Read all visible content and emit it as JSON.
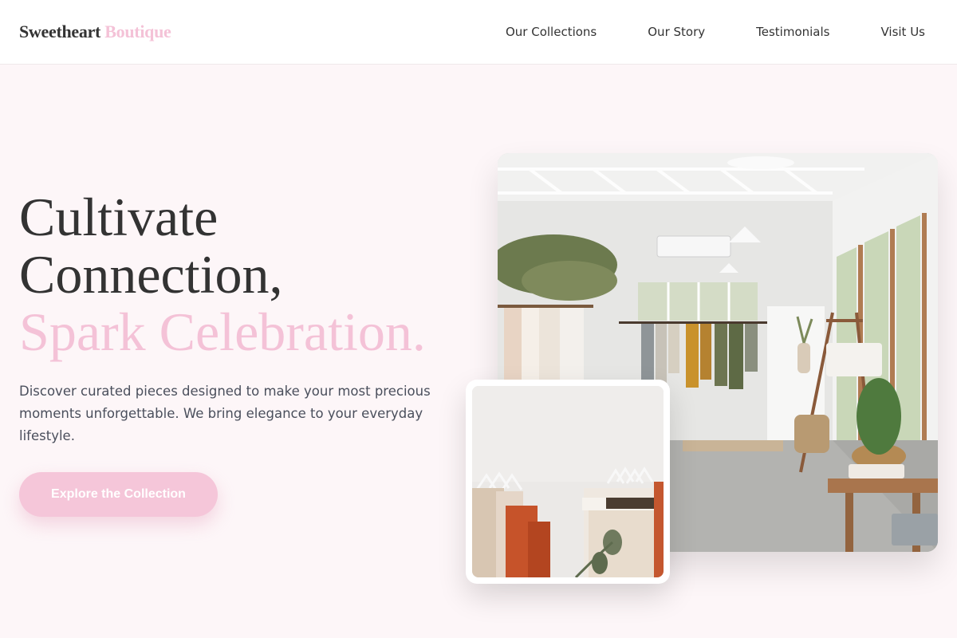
{
  "brand": {
    "name": "Sweetheart",
    "accent": "Boutique"
  },
  "nav": {
    "items": [
      {
        "label": "Our Collections"
      },
      {
        "label": "Our Story"
      },
      {
        "label": "Testimonials"
      },
      {
        "label": "Visit Us"
      }
    ]
  },
  "hero": {
    "title_line1": "Cultivate",
    "title_line2": "Connection,",
    "title_line3": "Spark Celebration.",
    "description": "Discover curated pieces designed to make your most precious moments unforgettable. We bring elegance to your everyday lifestyle.",
    "cta_label": "Explore the Collection"
  },
  "colors": {
    "accent_pink": "#f4c2d7",
    "background": "#fdf6f8",
    "text_dark": "#333333"
  }
}
